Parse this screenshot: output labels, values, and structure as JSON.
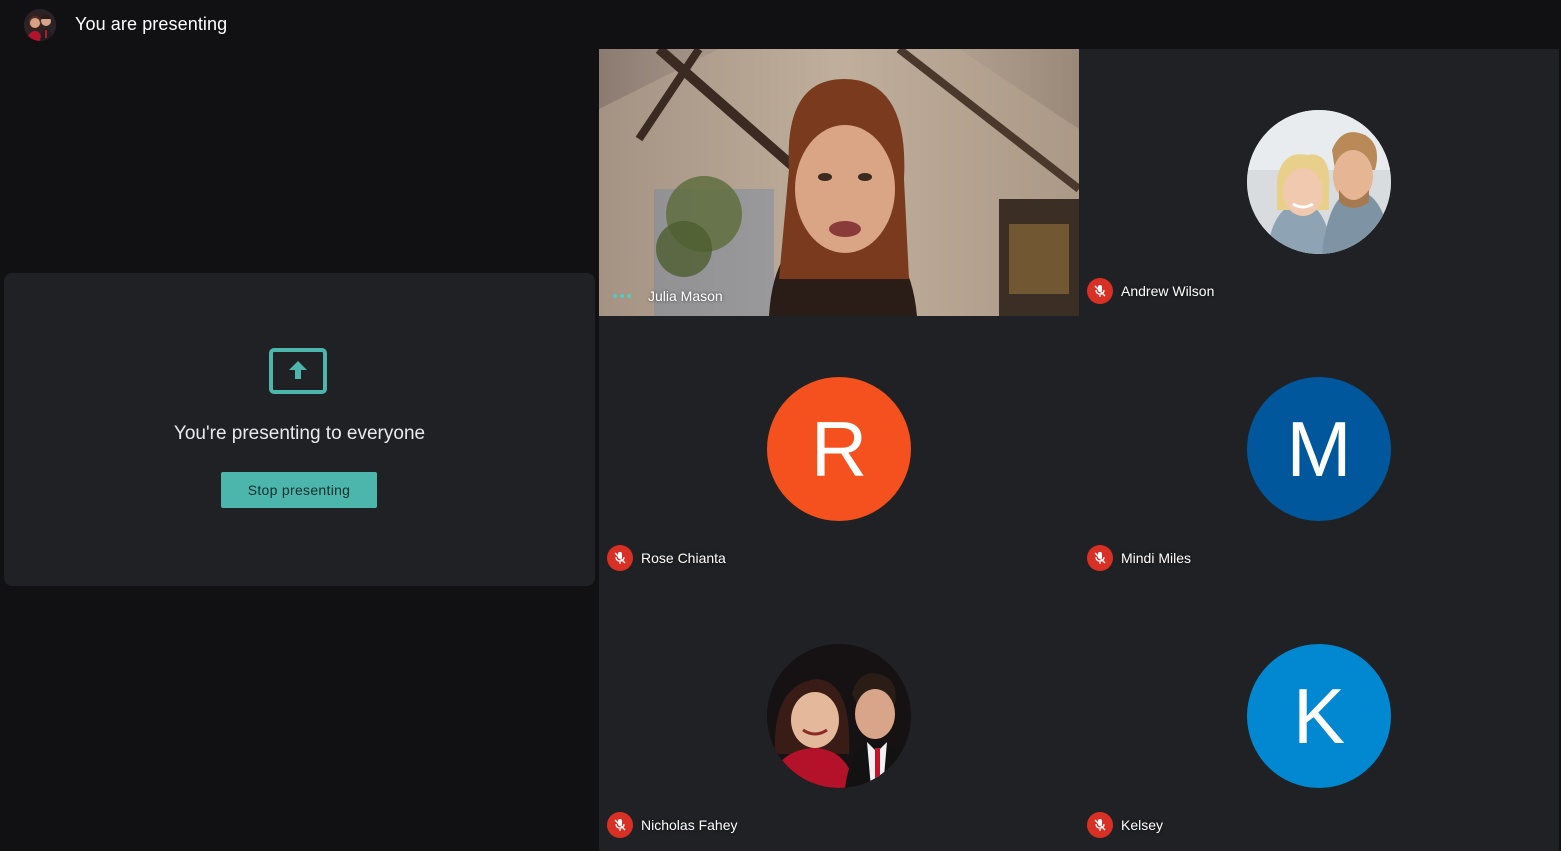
{
  "header": {
    "title": "You are presenting",
    "avatar_icon": "couple-photo-avatar"
  },
  "present_panel": {
    "icon": "present-to-all-icon",
    "message": "You're presenting to everyone",
    "stop_label": "Stop presenting",
    "accent": "#4db6ac"
  },
  "participants": [
    {
      "name": "Julia Mason",
      "type": "video",
      "status": "speaking"
    },
    {
      "name": "Andrew Wilson",
      "type": "photo",
      "muted": true
    },
    {
      "name": "Rose Chianta",
      "type": "initial",
      "initial": "R",
      "color": "#f4511e",
      "muted": true
    },
    {
      "name": "Mindi Miles",
      "type": "initial",
      "initial": "M",
      "color": "#01579b",
      "muted": true
    },
    {
      "name": "Nicholas Fahey",
      "type": "photo",
      "muted": true
    },
    {
      "name": "Kelsey",
      "type": "initial",
      "initial": "K",
      "color": "#0288d1",
      "muted": true
    }
  ],
  "colors": {
    "muted_badge": "#d93025",
    "tile_bg": "#202124",
    "page_bg": "#111113"
  }
}
